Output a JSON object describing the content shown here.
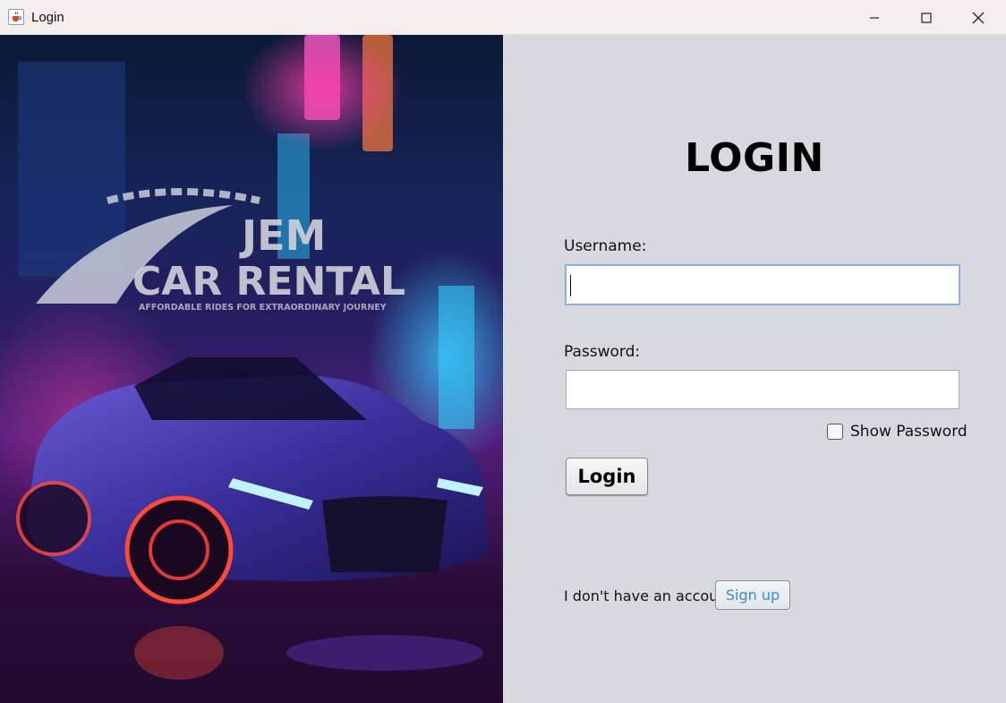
{
  "window": {
    "title": "Login",
    "icons": {
      "app": "java-cup-icon",
      "minimize": "minimize-icon",
      "maximize": "maximize-icon",
      "close": "close-icon"
    }
  },
  "banner": {
    "logo_text_line1": "JEM",
    "logo_text_line2": "CAR RENTAL",
    "logo_tagline": "AFFORDABLE RIDES FOR EXTRAORDINARY JOURNEY"
  },
  "form": {
    "heading": "LOGIN",
    "username_label": "Username:",
    "username_value": "",
    "password_label": "Password:",
    "password_value": "",
    "show_password_label": "Show Password",
    "show_password_checked": false,
    "login_button": "Login",
    "no_account_text": "I don't have an account",
    "signup_button": "Sign up"
  },
  "colors": {
    "panel_bg": "#d7d9df",
    "titlebar_bg": "#f5eeee",
    "signup_text": "#2f8fd8",
    "focus_border": "#8fb0d8"
  }
}
